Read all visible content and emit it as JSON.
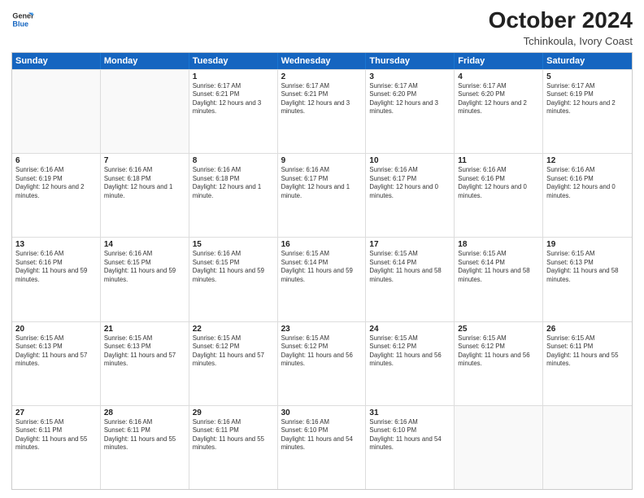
{
  "header": {
    "logo_line1": "General",
    "logo_line2": "Blue",
    "main_title": "October 2024",
    "subtitle": "Tchinkoula, Ivory Coast"
  },
  "calendar": {
    "days": [
      "Sunday",
      "Monday",
      "Tuesday",
      "Wednesday",
      "Thursday",
      "Friday",
      "Saturday"
    ],
    "rows": [
      [
        {
          "date": "",
          "info": ""
        },
        {
          "date": "",
          "info": ""
        },
        {
          "date": "1",
          "info": "Sunrise: 6:17 AM\nSunset: 6:21 PM\nDaylight: 12 hours and 3 minutes."
        },
        {
          "date": "2",
          "info": "Sunrise: 6:17 AM\nSunset: 6:21 PM\nDaylight: 12 hours and 3 minutes."
        },
        {
          "date": "3",
          "info": "Sunrise: 6:17 AM\nSunset: 6:20 PM\nDaylight: 12 hours and 3 minutes."
        },
        {
          "date": "4",
          "info": "Sunrise: 6:17 AM\nSunset: 6:20 PM\nDaylight: 12 hours and 2 minutes."
        },
        {
          "date": "5",
          "info": "Sunrise: 6:17 AM\nSunset: 6:19 PM\nDaylight: 12 hours and 2 minutes."
        }
      ],
      [
        {
          "date": "6",
          "info": "Sunrise: 6:16 AM\nSunset: 6:19 PM\nDaylight: 12 hours and 2 minutes."
        },
        {
          "date": "7",
          "info": "Sunrise: 6:16 AM\nSunset: 6:18 PM\nDaylight: 12 hours and 1 minute."
        },
        {
          "date": "8",
          "info": "Sunrise: 6:16 AM\nSunset: 6:18 PM\nDaylight: 12 hours and 1 minute."
        },
        {
          "date": "9",
          "info": "Sunrise: 6:16 AM\nSunset: 6:17 PM\nDaylight: 12 hours and 1 minute."
        },
        {
          "date": "10",
          "info": "Sunrise: 6:16 AM\nSunset: 6:17 PM\nDaylight: 12 hours and 0 minutes."
        },
        {
          "date": "11",
          "info": "Sunrise: 6:16 AM\nSunset: 6:16 PM\nDaylight: 12 hours and 0 minutes."
        },
        {
          "date": "12",
          "info": "Sunrise: 6:16 AM\nSunset: 6:16 PM\nDaylight: 12 hours and 0 minutes."
        }
      ],
      [
        {
          "date": "13",
          "info": "Sunrise: 6:16 AM\nSunset: 6:16 PM\nDaylight: 11 hours and 59 minutes."
        },
        {
          "date": "14",
          "info": "Sunrise: 6:16 AM\nSunset: 6:15 PM\nDaylight: 11 hours and 59 minutes."
        },
        {
          "date": "15",
          "info": "Sunrise: 6:16 AM\nSunset: 6:15 PM\nDaylight: 11 hours and 59 minutes."
        },
        {
          "date": "16",
          "info": "Sunrise: 6:15 AM\nSunset: 6:14 PM\nDaylight: 11 hours and 59 minutes."
        },
        {
          "date": "17",
          "info": "Sunrise: 6:15 AM\nSunset: 6:14 PM\nDaylight: 11 hours and 58 minutes."
        },
        {
          "date": "18",
          "info": "Sunrise: 6:15 AM\nSunset: 6:14 PM\nDaylight: 11 hours and 58 minutes."
        },
        {
          "date": "19",
          "info": "Sunrise: 6:15 AM\nSunset: 6:13 PM\nDaylight: 11 hours and 58 minutes."
        }
      ],
      [
        {
          "date": "20",
          "info": "Sunrise: 6:15 AM\nSunset: 6:13 PM\nDaylight: 11 hours and 57 minutes."
        },
        {
          "date": "21",
          "info": "Sunrise: 6:15 AM\nSunset: 6:13 PM\nDaylight: 11 hours and 57 minutes."
        },
        {
          "date": "22",
          "info": "Sunrise: 6:15 AM\nSunset: 6:12 PM\nDaylight: 11 hours and 57 minutes."
        },
        {
          "date": "23",
          "info": "Sunrise: 6:15 AM\nSunset: 6:12 PM\nDaylight: 11 hours and 56 minutes."
        },
        {
          "date": "24",
          "info": "Sunrise: 6:15 AM\nSunset: 6:12 PM\nDaylight: 11 hours and 56 minutes."
        },
        {
          "date": "25",
          "info": "Sunrise: 6:15 AM\nSunset: 6:12 PM\nDaylight: 11 hours and 56 minutes."
        },
        {
          "date": "26",
          "info": "Sunrise: 6:15 AM\nSunset: 6:11 PM\nDaylight: 11 hours and 55 minutes."
        }
      ],
      [
        {
          "date": "27",
          "info": "Sunrise: 6:15 AM\nSunset: 6:11 PM\nDaylight: 11 hours and 55 minutes."
        },
        {
          "date": "28",
          "info": "Sunrise: 6:16 AM\nSunset: 6:11 PM\nDaylight: 11 hours and 55 minutes."
        },
        {
          "date": "29",
          "info": "Sunrise: 6:16 AM\nSunset: 6:11 PM\nDaylight: 11 hours and 55 minutes."
        },
        {
          "date": "30",
          "info": "Sunrise: 6:16 AM\nSunset: 6:10 PM\nDaylight: 11 hours and 54 minutes."
        },
        {
          "date": "31",
          "info": "Sunrise: 6:16 AM\nSunset: 6:10 PM\nDaylight: 11 hours and 54 minutes."
        },
        {
          "date": "",
          "info": ""
        },
        {
          "date": "",
          "info": ""
        }
      ]
    ]
  }
}
